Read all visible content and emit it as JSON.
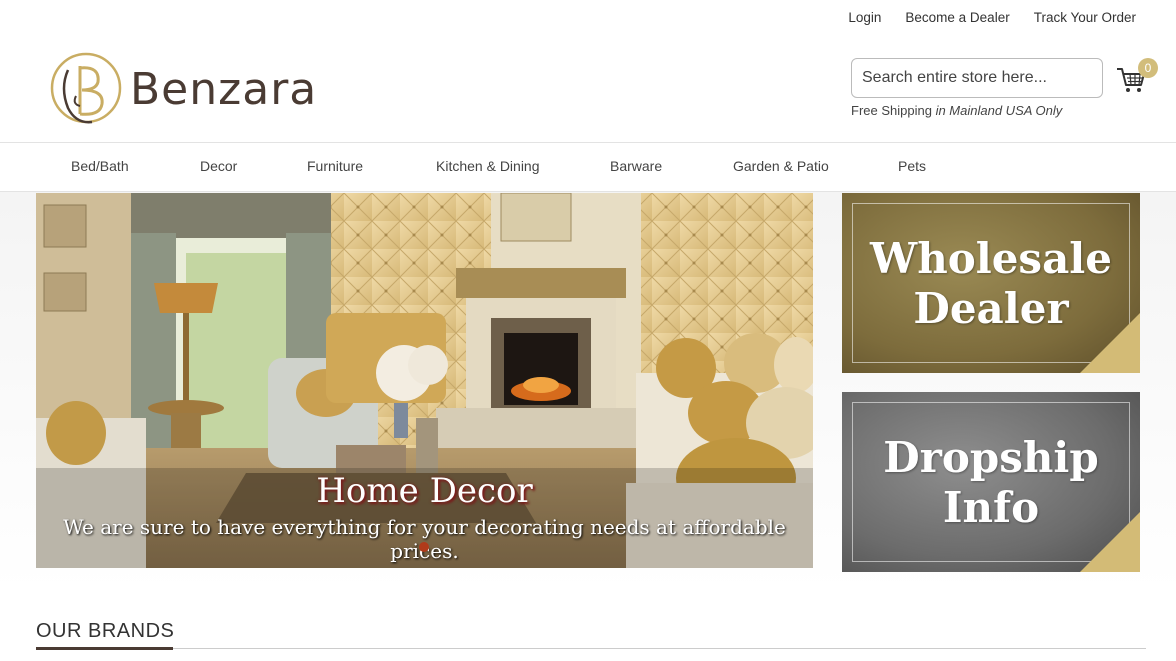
{
  "top_links": {
    "login": "Login",
    "become_dealer": "Become a Dealer",
    "track_order": "Track Your Order"
  },
  "logo": {
    "text": "Benzara",
    "monogram": "B"
  },
  "search": {
    "placeholder": "Search entire store here..."
  },
  "shipping": {
    "prefix": "Free Shipping",
    "suffix": "in Mainland USA Only"
  },
  "cart": {
    "count": "0",
    "icon": "shopping-cart-icon"
  },
  "nav": {
    "items": [
      {
        "label": "Bed/Bath"
      },
      {
        "label": "Decor"
      },
      {
        "label": "Furniture"
      },
      {
        "label": "Kitchen & Dining"
      },
      {
        "label": "Barware"
      },
      {
        "label": "Garden & Patio"
      },
      {
        "label": "Pets"
      }
    ]
  },
  "hero": {
    "title": "Home Decor",
    "subtitle": "We are sure to have everything for your decorating needs at affordable prices."
  },
  "promos": {
    "wholesale": {
      "line1": "Wholesale",
      "line2": "Dealer"
    },
    "dropship": {
      "line1": "Dropship",
      "line2": "Info"
    }
  },
  "brands": {
    "heading": "OUR BRANDS"
  },
  "colors": {
    "accent_gold": "#d3bb76",
    "logo_brown": "#4a3b33",
    "slider_dot": "#b03a1a"
  }
}
